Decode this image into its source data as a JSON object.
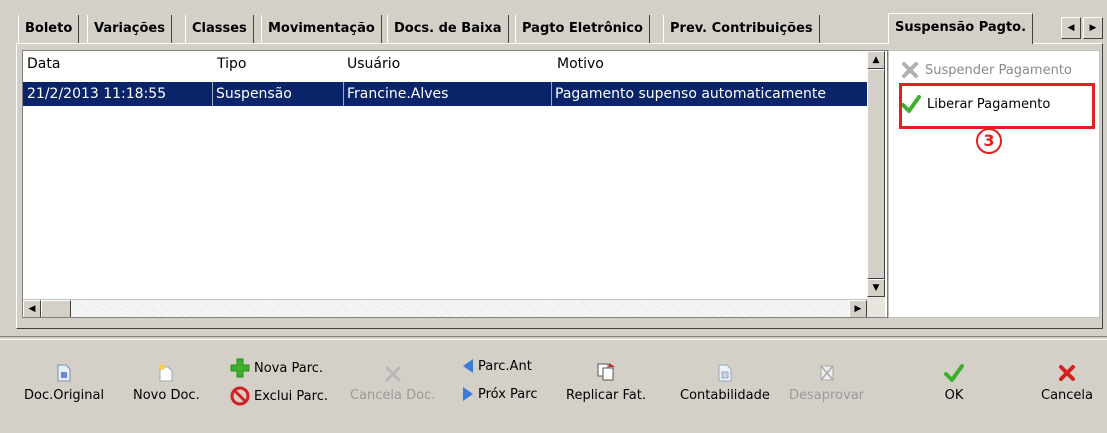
{
  "tabs": [
    {
      "label": "Boleto"
    },
    {
      "label": "Variações"
    },
    {
      "label": "Classes"
    },
    {
      "label": "Movimentação"
    },
    {
      "label": "Docs. de Baixa"
    },
    {
      "label": "Pagto Eletrônico"
    },
    {
      "label": "Prev. Contribuições"
    },
    {
      "label": "Suspensão Pagto."
    }
  ],
  "grid": {
    "columns": [
      "Data",
      "Tipo",
      "Usuário",
      "Motivo"
    ],
    "rows": [
      {
        "data": "21/2/2013 11:18:55",
        "tipo": "Suspensão",
        "usuario": "Francine.Alves",
        "motivo": "Pagamento supenso automaticamente"
      }
    ]
  },
  "actions": {
    "suspender": "Suspender Pagamento",
    "liberar": "Liberar Pagamento",
    "step": "3"
  },
  "toolbar": {
    "doc_original": "Doc.Original",
    "novo_doc": "Novo Doc.",
    "nova_parc": "Nova Parc.",
    "exclui_parc": "Exclui Parc.",
    "cancela_doc": "Cancela Doc.",
    "parc_ant": "Parc.Ant",
    "prox_parc": "Próx Parc",
    "replicar_fat": "Replicar Fat.",
    "contabilidade": "Contabilidade",
    "desaprovar": "Desaprovar",
    "ok": "OK",
    "cancela": "Cancela"
  },
  "colors": {
    "selection": "#0a246a",
    "highlight_box": "#e41f1f",
    "ok_green": "#3cb02c",
    "cancel_red": "#d32020"
  }
}
